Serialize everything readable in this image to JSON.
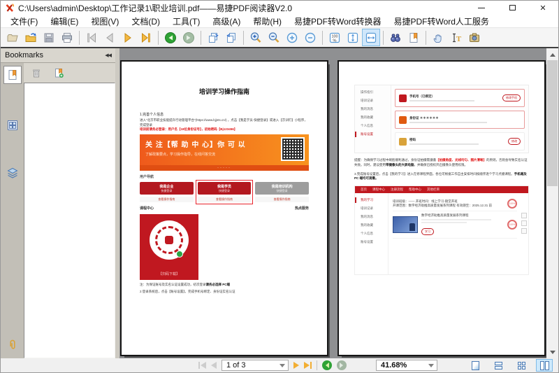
{
  "window": {
    "title": "C:\\Users\\admin\\Desktop\\工作记录1\\职业培训.pdf——易捷PDF阅读器V2.0",
    "minimize": "—",
    "maximize": "",
    "close": "✕"
  },
  "menu": {
    "items": [
      "文件(F)",
      "编辑(E)",
      "视图(V)",
      "文档(D)",
      "工具(T)",
      "高级(A)",
      "帮助(H)",
      "易捷PDF转Word转换器",
      "易捷PDF转Word人工服务"
    ]
  },
  "toolbar": {
    "icons": [
      "open-folder",
      "open-file",
      "save",
      "print",
      "first-page",
      "prev-page",
      "next-page",
      "last-page",
      "previous-view",
      "next-view",
      "insert-pages",
      "extract-pages",
      "zoom-in-tool",
      "zoom-out-tool",
      "zoom-in",
      "zoom-out",
      "actual-size",
      "fit-page",
      "fit-width",
      "find",
      "bookmark",
      "hand-tool",
      "select-text",
      "snapshot"
    ],
    "selected_tool": "fit-width"
  },
  "sidebar": {
    "title": "Bookmarks",
    "collapse": "◀◀",
    "tabs": [
      "bookmarks",
      "thumbnails",
      "layers",
      "attachments"
    ]
  },
  "statusbar": {
    "page_indicator": "1 of 3",
    "zoom_level": "41.68%",
    "layouts": [
      "single-page",
      "continuous",
      "facing",
      "book-view"
    ],
    "selected_layout": "book-view"
  },
  "pages": [
    {
      "title": "培训学习操作指南",
      "step1_heading": "1.完善个人信息",
      "step1_text": "进入“北京市职业技能提升行动管理平台”(https://www.bjjnts.cn/) ，点击【我是学员-快捷登录】或进入【京训钉】小程序，完成登录",
      "step1_red": "培训前请务必登录：用户名【18位身份证号】，初始密码【Bj123456】",
      "banner_title": "关 注【帮 助 中 心】你 可 以",
      "banner_sub": "了解政策要点，学习操作指导，在线问答交流",
      "banner_dots": "·····",
      "nav_label": "用户导航",
      "nav_buttons": [
        {
          "label": "我是企业",
          "sub": "快捷登录",
          "link": "查看操作指南"
        },
        {
          "label": "我是学员",
          "sub": "快捷登录",
          "link": "查看操作指南"
        },
        {
          "label": "我是培训机构",
          "sub": "快捷登录",
          "link": "查看操作指南"
        }
      ],
      "row_left": "课程中心",
      "row_right": "热点服务",
      "qr_caption": "【扫码下载】",
      "note_a": "注：为保证账号及实名认证设置成功，初次登录",
      "note_b": "请务必选择 PC端",
      "step2": "2.登录系统后，点击【账号设置】，完成手机号绑定、身份证实名认证"
    },
    {
      "settings_menu": [
        "操作指引",
        "培训记录",
        "我的消息",
        "我的收藏",
        "个人信息",
        "账号设置"
      ],
      "settings_rows": [
        {
          "title": "手机号（已绑定）",
          "button": "修改手机"
        },
        {
          "title": "身份证 ＊＊＊＊＊＊",
          "button": ""
        },
        {
          "title": "密码",
          "button": "修改"
        }
      ],
      "para1_a": "提醒：为确保学习过程中刷脸顺利通过，身份证拍摄需遵循",
      "para1_b": "【拍摄角度、光线均匀、图片清晰】",
      "para1_c": "的原则，否则会导致实名认证失败。同时，建议使用",
      "para1_d": "带摄像头的大屏电脑",
      "para1_e": "，并确保已授权开启摄像头使用权限。",
      "step3_a": "3.完成账号设置后，点击【我的学习】进入在修课程界面，各位可根据工作自主安排时间按顺序逐个学习点播课程。",
      "step3_b": "手机端及 PC 端均可观看。",
      "lms_nav": [
        "首页",
        "课程中心",
        "注册流程",
        "帮助中心",
        "其他栏目"
      ],
      "lms_menu": [
        "我的学习",
        "培训记录",
        "我的消息",
        "我的收藏",
        "个人信息",
        "账号设置"
      ],
      "course1_line1": "培训班级：——    开班时间：线上学习-随堂开班",
      "course1_line2": "开课范围：数字经济助推高质量发展系列课程    有效期至：2025.12.31 前",
      "course1_progress": "100%",
      "course2_title": "数字经济助推高质量发展系列课程",
      "course2_button": "学习",
      "course2_progress": "100%"
    }
  ]
}
